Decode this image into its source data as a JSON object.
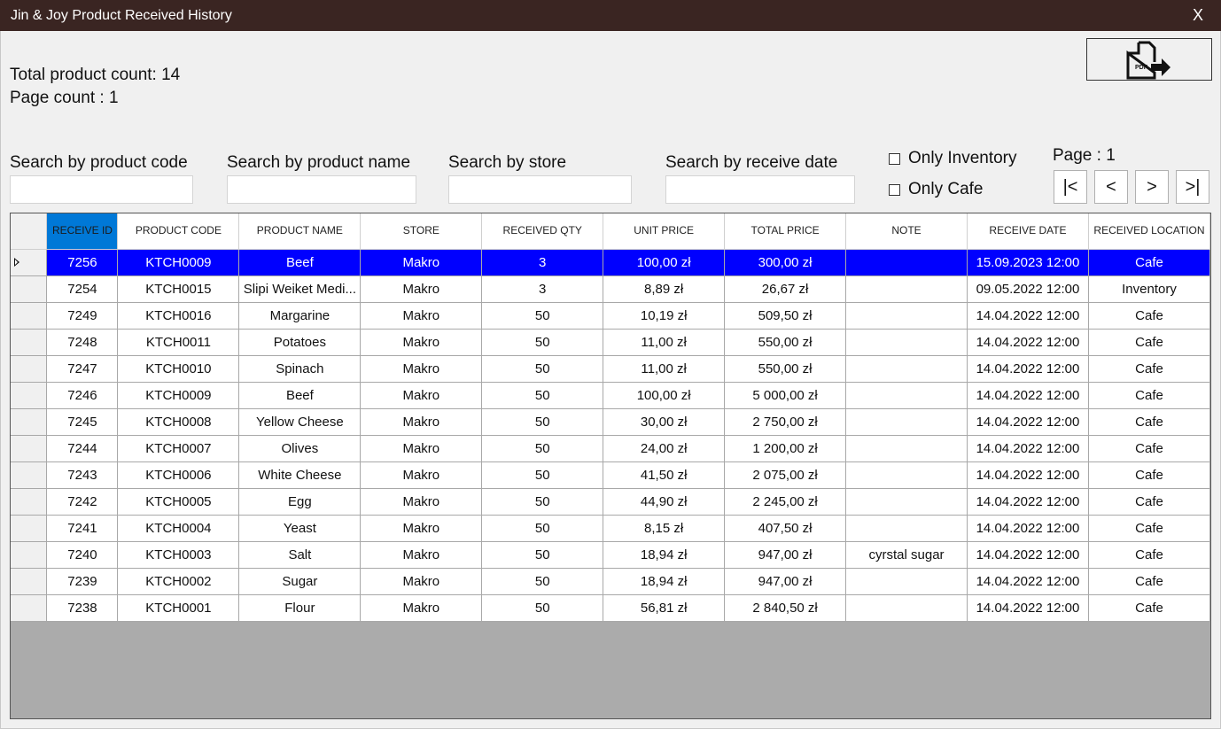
{
  "window": {
    "title": "Jin & Joy Product Received History",
    "close_label": "X"
  },
  "stats": {
    "total": "Total product count: 14",
    "pages": "Page count : 1"
  },
  "pdf_export": {
    "icon": "pdf-export-icon",
    "label": "PDF"
  },
  "search": {
    "product_code": {
      "label": "Search by product code",
      "value": ""
    },
    "product_name": {
      "label": "Search by product name",
      "value": ""
    },
    "store": {
      "label": "Search by store",
      "value": ""
    },
    "receive_date": {
      "label": "Search by receive date",
      "value": ""
    }
  },
  "filters": {
    "only_inventory": "Only Inventory",
    "only_cafe": "Only Cafe"
  },
  "pagination": {
    "label": "Page : 1",
    "first": "|<",
    "prev": "<",
    "next": ">",
    "last": ">|"
  },
  "table": {
    "columns": [
      "RECEIVE ID",
      "PRODUCT CODE",
      "PRODUCT NAME",
      "STORE",
      "RECEIVED QTY",
      "UNIT PRICE",
      "TOTAL PRICE",
      "NOTE",
      "RECEIVE DATE",
      "RECEIVED LOCATION"
    ],
    "selected_row": 0,
    "rows": [
      [
        "7256",
        "KTCH0009",
        "Beef",
        "Makro",
        "3",
        "100,00 zł",
        "300,00 zł",
        "",
        "15.09.2023 12:00",
        "Cafe"
      ],
      [
        "7254",
        "KTCH0015",
        "Slipi Weiket Medi...",
        "Makro",
        "3",
        "8,89 zł",
        "26,67 zł",
        "",
        "09.05.2022 12:00",
        "Inventory"
      ],
      [
        "7249",
        "KTCH0016",
        "Margarine",
        "Makro",
        "50",
        "10,19 zł",
        "509,50 zł",
        "",
        "14.04.2022 12:00",
        "Cafe"
      ],
      [
        "7248",
        "KTCH0011",
        "Potatoes",
        "Makro",
        "50",
        "11,00 zł",
        "550,00 zł",
        "",
        "14.04.2022 12:00",
        "Cafe"
      ],
      [
        "7247",
        "KTCH0010",
        "Spinach",
        "Makro",
        "50",
        "11,00 zł",
        "550,00 zł",
        "",
        "14.04.2022 12:00",
        "Cafe"
      ],
      [
        "7246",
        "KTCH0009",
        "Beef",
        "Makro",
        "50",
        "100,00 zł",
        "5 000,00 zł",
        "",
        "14.04.2022 12:00",
        "Cafe"
      ],
      [
        "7245",
        "KTCH0008",
        "Yellow Cheese",
        "Makro",
        "50",
        "30,00 zł",
        "2 750,00 zł",
        "",
        "14.04.2022 12:00",
        "Cafe"
      ],
      [
        "7244",
        "KTCH0007",
        "Olives",
        "Makro",
        "50",
        "24,00 zł",
        "1 200,00 zł",
        "",
        "14.04.2022 12:00",
        "Cafe"
      ],
      [
        "7243",
        "KTCH0006",
        "White Cheese",
        "Makro",
        "50",
        "41,50 zł",
        "2 075,00 zł",
        "",
        "14.04.2022 12:00",
        "Cafe"
      ],
      [
        "7242",
        "KTCH0005",
        "Egg",
        "Makro",
        "50",
        "44,90 zł",
        "2 245,00 zł",
        "",
        "14.04.2022 12:00",
        "Cafe"
      ],
      [
        "7241",
        "KTCH0004",
        "Yeast",
        "Makro",
        "50",
        "8,15 zł",
        "407,50 zł",
        "",
        "14.04.2022 12:00",
        "Cafe"
      ],
      [
        "7240",
        "KTCH0003",
        "Salt",
        "Makro",
        "50",
        "18,94 zł",
        "947,00 zł",
        "cyrstal sugar",
        "14.04.2022 12:00",
        "Cafe"
      ],
      [
        "7239",
        "KTCH0002",
        "Sugar",
        "Makro",
        "50",
        "18,94 zł",
        "947,00 zł",
        "",
        "14.04.2022 12:00",
        "Cafe"
      ],
      [
        "7238",
        "KTCH0001",
        "Flour",
        "Makro",
        "50",
        "56,81 zł",
        "2 840,50 zł",
        "",
        "14.04.2022 12:00",
        "Cafe"
      ]
    ]
  },
  "colors": {
    "titlebar": "#3a2522",
    "selection": "#0000ff",
    "header_selected": "#0078d7",
    "grid_empty": "#ababab"
  }
}
